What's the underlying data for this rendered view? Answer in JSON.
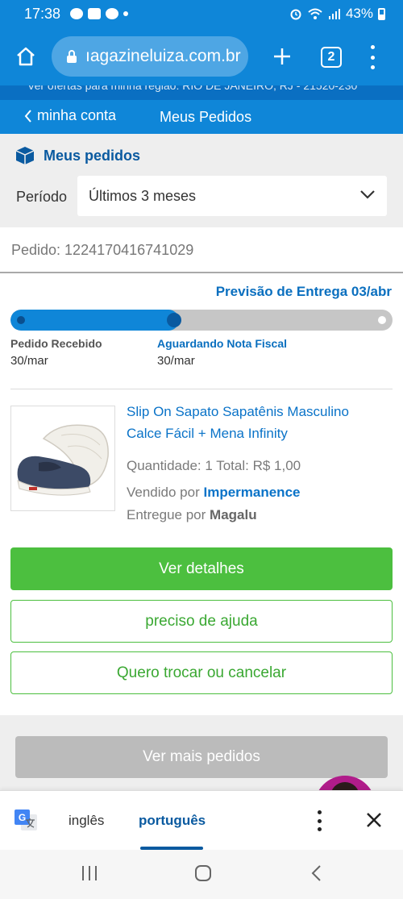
{
  "status_bar": {
    "time": "17:38",
    "battery": "43%"
  },
  "browser": {
    "url": "ıagazineluiza.com.br",
    "tab_count": "2"
  },
  "banner": {
    "text": "Ver ofertas para minha região: RIO DE JANEIRO, RJ - 21520-230"
  },
  "nav": {
    "back_label": "minha conta",
    "title": "Meus Pedidos"
  },
  "filter": {
    "section_title": "Meus pedidos",
    "period_label": "Período",
    "period_value": "Últimos 3 meses"
  },
  "order": {
    "number_label": "Pedido: 1224170416741029",
    "delivery_forecast": "Previsão de Entrega 03/abr",
    "progress": 0.44,
    "steps": [
      {
        "label": "Pedido Recebido",
        "date": "30/mar"
      },
      {
        "label": "Aguardando Nota Fiscal",
        "date": "30/mar"
      }
    ],
    "product": {
      "name": "Slip On Sapato Sapatênis Masculino Calce Fácil + Mena Infinity",
      "quantity_text": "Quantidade: 1  Total: R$ 1,00",
      "sold_by_prefix": "Vendido por",
      "seller": "Impermanence",
      "delivered_by_prefix": "Entregue por",
      "deliverer": "Magalu"
    },
    "buttons": {
      "details": "Ver detalhes",
      "help": "preciso de ajuda",
      "exchange": "Quero trocar ou cancelar"
    }
  },
  "more_orders": "Ver mais pedidos",
  "translate_bar": {
    "source_lang": "inglês",
    "target_lang": "português"
  },
  "colors": {
    "brand_blue": "#0f86d8",
    "accent_green": "#4cbf3f",
    "link_blue": "#0a73c8"
  }
}
